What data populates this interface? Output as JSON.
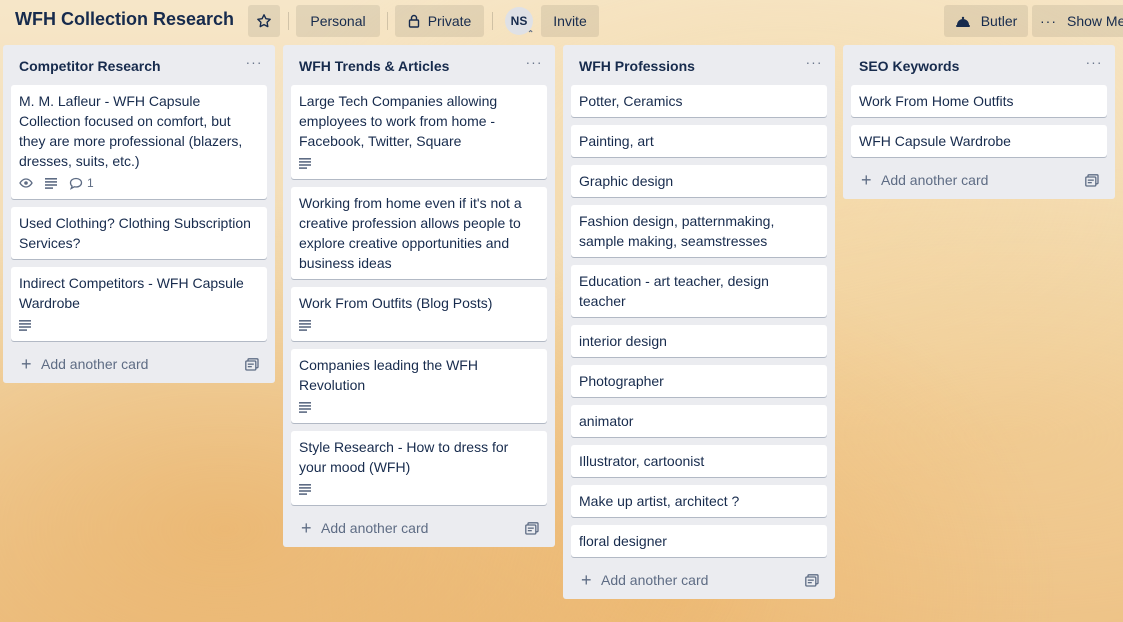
{
  "board": {
    "title": "WFH Collection Research",
    "visibility_team": "Personal",
    "visibility": "Private",
    "member_initials": "NS",
    "invite_label": "Invite",
    "butler_label": "Butler",
    "show_menu_label": "Show Me"
  },
  "add_card_label": "Add another card",
  "lists": [
    {
      "title": "Competitor Research",
      "cards": [
        {
          "text": "M. M. Lafleur - WFH Capsule Collection focused on comfort, but they are more professional (blazers, dresses, suits, etc.)",
          "watch": true,
          "desc": true,
          "comments": "1"
        },
        {
          "text": "Used Clothing? Clothing Subscription Services?"
        },
        {
          "text": "Indirect Competitors - WFH Capsule Wardrobe",
          "desc": true
        }
      ]
    },
    {
      "title": "WFH Trends & Articles",
      "cards": [
        {
          "text": "Large Tech Companies allowing employees to work from home - Facebook, Twitter, Square",
          "desc": true
        },
        {
          "text": "Working from home even if it's not a creative profession allows people to explore creative opportunities and business ideas"
        },
        {
          "text": "Work From Outfits (Blog Posts)",
          "desc": true
        },
        {
          "text": "Companies leading the WFH Revolution",
          "desc": true
        },
        {
          "text": "Style Research - How to dress for your mood (WFH)",
          "desc": true
        }
      ]
    },
    {
      "title": "WFH Professions",
      "cards": [
        {
          "text": "Potter, Ceramics"
        },
        {
          "text": "Painting, art"
        },
        {
          "text": "Graphic design"
        },
        {
          "text": "Fashion design, patternmaking, sample making, seamstresses"
        },
        {
          "text": "Education - art teacher, design teacher"
        },
        {
          "text": "interior design"
        },
        {
          "text": "Photographer"
        },
        {
          "text": "animator"
        },
        {
          "text": "Illustrator, cartoonist"
        },
        {
          "text": "Make up artist, architect ?"
        },
        {
          "text": "floral designer"
        }
      ]
    },
    {
      "title": "SEO Keywords",
      "cards": [
        {
          "text": "Work From Home Outfits"
        },
        {
          "text": "WFH Capsule Wardrobe"
        }
      ]
    }
  ]
}
